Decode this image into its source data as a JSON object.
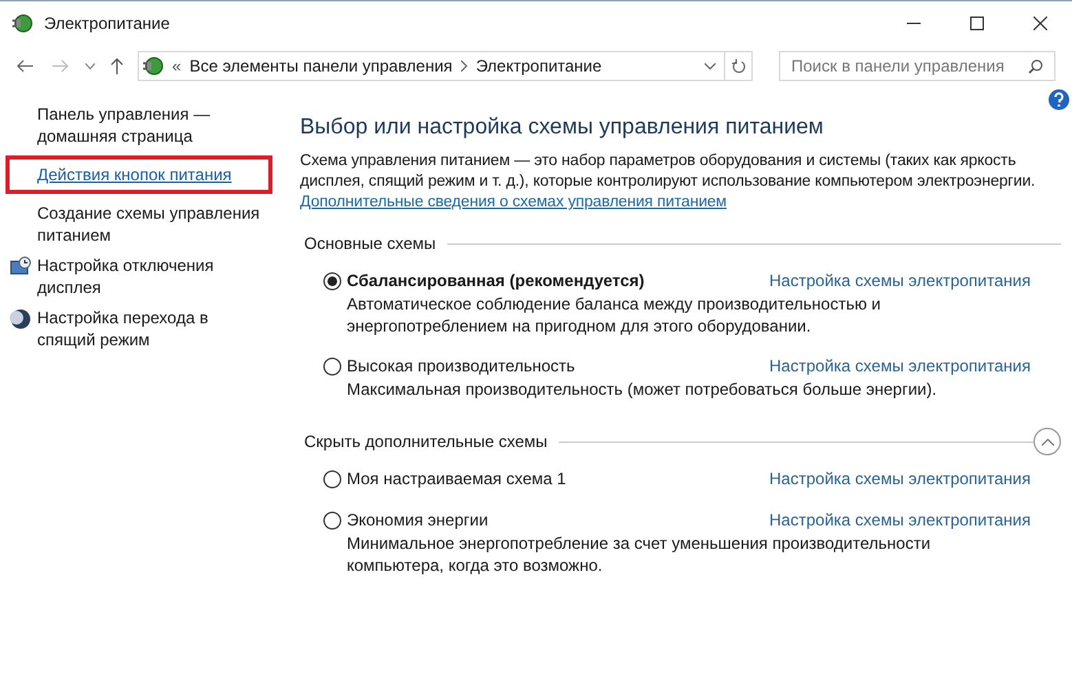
{
  "window": {
    "title": "Электропитание"
  },
  "address": {
    "overflow": "«",
    "path": [
      "Все элементы панели управления",
      "Электропитание"
    ]
  },
  "search": {
    "placeholder": "Поиск в панели управления"
  },
  "sidebar": {
    "items": [
      {
        "label": "Панель управления — домашняя страница",
        "kind": "home",
        "highlighted": false
      },
      {
        "label": "Действия кнопок питания",
        "kind": "link",
        "highlighted": true
      },
      {
        "label": "Создание схемы управления питанием",
        "kind": "plain",
        "highlighted": false
      },
      {
        "label": "Настройка отключения дисплея",
        "kind": "display",
        "highlighted": false
      },
      {
        "label": "Настройка перехода в спящий режим",
        "kind": "sleep",
        "highlighted": false
      }
    ]
  },
  "content": {
    "heading": "Выбор или настройка схемы управления питанием",
    "intro": "Схема управления питанием — это набор параметров оборудования и системы (таких как яркость дисплея, спящий режим и т. д.), которые контролируют использование компьютером электроэнергии.",
    "intro_link": "Дополнительные сведения о схемах управления питанием",
    "groups": [
      {
        "title": "Основные схемы",
        "collapsible": false,
        "schemes": [
          {
            "name": "Сбалансированная (рекомендуется)",
            "selected": true,
            "link": "Настройка схемы электропитания",
            "description": "Автоматическое соблюдение баланса между производительностью и энергопотреблением на пригодном для этого оборудовании."
          },
          {
            "name": "Высокая производительность",
            "selected": false,
            "link": "Настройка схемы электропитания",
            "description": "Максимальная производительность (может потребоваться больше энергии)."
          }
        ]
      },
      {
        "title": "Скрыть дополнительные схемы",
        "collapsible": true,
        "schemes": [
          {
            "name": "Моя настраиваемая схема 1",
            "selected": false,
            "link": "Настройка схемы электропитания"
          },
          {
            "name": "Экономия энергии",
            "selected": false,
            "link": "Настройка схемы электропитания",
            "description": "Минимальное энергопотребление за счет уменьшения производительности компьютера, когда это возможно."
          }
        ]
      }
    ]
  }
}
